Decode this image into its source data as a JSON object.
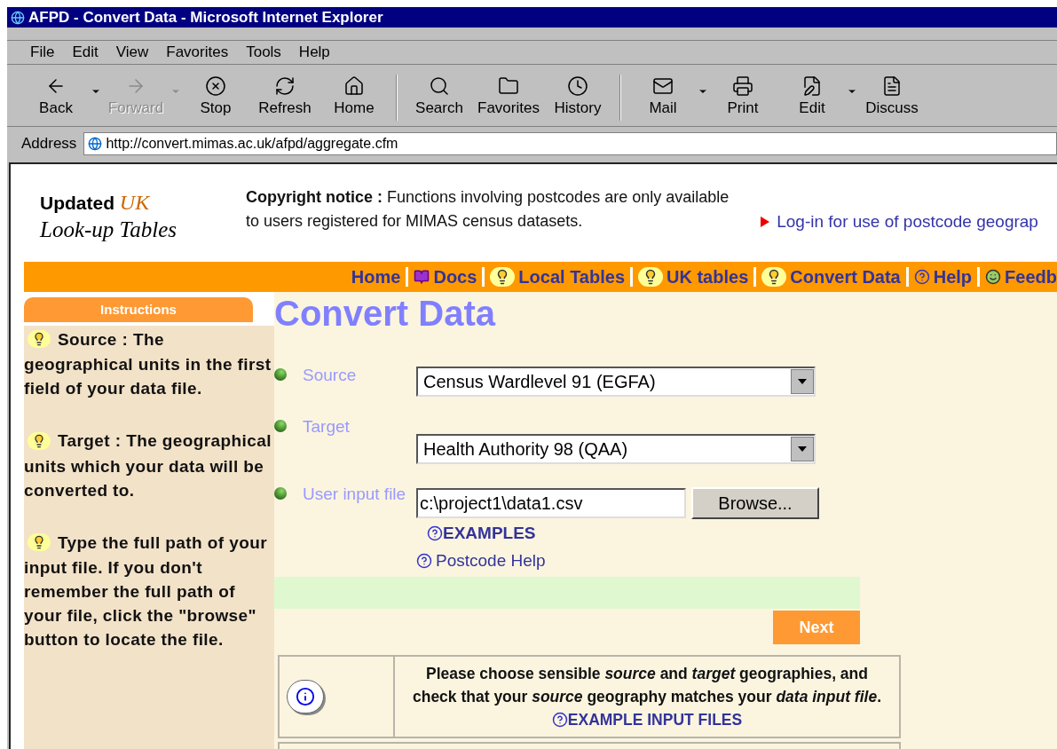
{
  "window": {
    "title": "AFPD - Convert Data - Microsoft Internet Explorer"
  },
  "menu": [
    "File",
    "Edit",
    "View",
    "Favorites",
    "Tools",
    "Help"
  ],
  "toolbar": [
    {
      "kind": "back",
      "label": "Back",
      "disabled": false,
      "dropdown": true
    },
    {
      "kind": "forward",
      "label": "Forward",
      "disabled": true,
      "dropdown": true
    },
    {
      "kind": "stop",
      "label": "Stop",
      "disabled": false,
      "dropdown": false
    },
    {
      "kind": "refresh",
      "label": "Refresh",
      "disabled": false,
      "dropdown": false
    },
    {
      "kind": "home",
      "label": "Home",
      "disabled": false,
      "dropdown": false
    },
    {
      "kind": "sep"
    },
    {
      "kind": "search",
      "label": "Search",
      "disabled": false,
      "dropdown": false
    },
    {
      "kind": "favorites",
      "label": "Favorites",
      "disabled": false,
      "dropdown": false
    },
    {
      "kind": "history",
      "label": "History",
      "disabled": false,
      "dropdown": false
    },
    {
      "kind": "sep"
    },
    {
      "kind": "mail",
      "label": "Mail",
      "disabled": false,
      "dropdown": true
    },
    {
      "kind": "print",
      "label": "Print",
      "disabled": false,
      "dropdown": false
    },
    {
      "kind": "edit",
      "label": "Edit",
      "disabled": false,
      "dropdown": true
    },
    {
      "kind": "discuss",
      "label": "Discuss",
      "disabled": false,
      "dropdown": false
    }
  ],
  "address": {
    "label": "Address",
    "url": "http://convert.mimas.ac.uk/afpd/aggregate.cfm"
  },
  "page": {
    "logo": {
      "line1": "Updated",
      "accent": "UK",
      "line2": "Look-up Tables"
    },
    "copyright": [
      "**Copyright notice :** Functions involving postcodes are only available",
      "to users registered for MIMAS census datasets."
    ],
    "login_link": "Log-in for use of postcode geograp",
    "nav": [
      {
        "kind": "plain",
        "label": "Home"
      },
      {
        "kind": "book",
        "label": "Docs"
      },
      {
        "kind": "bulb",
        "label": "Local Tables"
      },
      {
        "kind": "bulb",
        "label": "UK tables"
      },
      {
        "kind": "bulb",
        "label": "Convert Data"
      },
      {
        "kind": "help",
        "label": "Help"
      },
      {
        "kind": "face",
        "label": "Feedb"
      }
    ],
    "sidebar": {
      "header": "Instructions",
      "tips": [
        "Source : The geographical units in the first field of your data file.",
        "Target : The geographical units which your data will be converted to.",
        "Type the full path of your input file. If you don't remember the full path of your file, click the \"browse\" button to locate the file."
      ]
    },
    "heading": "Convert Data",
    "form": [
      {
        "kind": "select",
        "label": "Source",
        "value": "Census Wardlevel 91 (EGFA)"
      },
      {
        "kind": "select",
        "label": "Target",
        "value": "Health Authority 98 (QAA)"
      },
      {
        "kind": "file",
        "label": "User input file",
        "value": "c:\\project1\\data1.csv",
        "button": "Browse..."
      }
    ],
    "links": [
      "EXAMPLES",
      "Postcode Help"
    ],
    "next_button": "Next",
    "notice": {
      "text": "Please choose sensible *source* and *target* geographies, and check that your *source* geography matches your *data input file*.",
      "link": "EXAMPLE INPUT FILES"
    }
  }
}
